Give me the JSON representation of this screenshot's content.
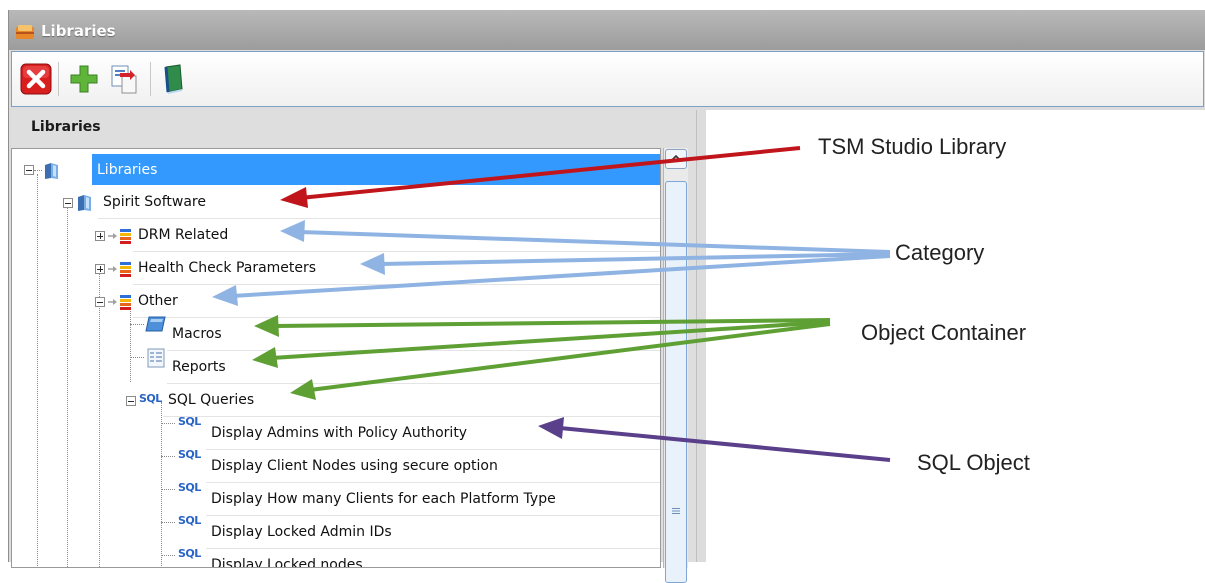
{
  "window": {
    "title": "Libraries",
    "title_icon": "library-icon"
  },
  "toolbar": {
    "buttons": [
      {
        "name": "close-button",
        "icon": "close-icon"
      },
      {
        "name": "add-button",
        "icon": "plus-icon"
      },
      {
        "name": "import-button",
        "icon": "import-icon"
      },
      {
        "name": "library-button",
        "icon": "book-icon"
      }
    ]
  },
  "panel": {
    "header": "Libraries"
  },
  "tree": {
    "root": "Libraries",
    "library": "Spirit Software",
    "categories": [
      "DRM Related",
      "Health Check Parameters",
      "Other"
    ],
    "containers": [
      "Macros",
      "Reports",
      "SQL Queries"
    ],
    "sql_objects": [
      "Display Admins with Policy Authority",
      "Display Client Nodes using secure option",
      "Display How many Clients for each Platform Type",
      "Display Locked Admin IDs",
      "Display Locked nodes"
    ],
    "sql_icon_text": "SQL"
  },
  "annotations": {
    "library": "TSM Studio Library",
    "category": "Category",
    "object_container": "Object Container",
    "sql_object": "SQL Object"
  },
  "colors": {
    "selection": "#3399ff",
    "arrow_library": "#c0151b",
    "arrow_category": "#8fb4e3",
    "arrow_container": "#5ea034",
    "arrow_sql_object": "#5a3f8a"
  }
}
